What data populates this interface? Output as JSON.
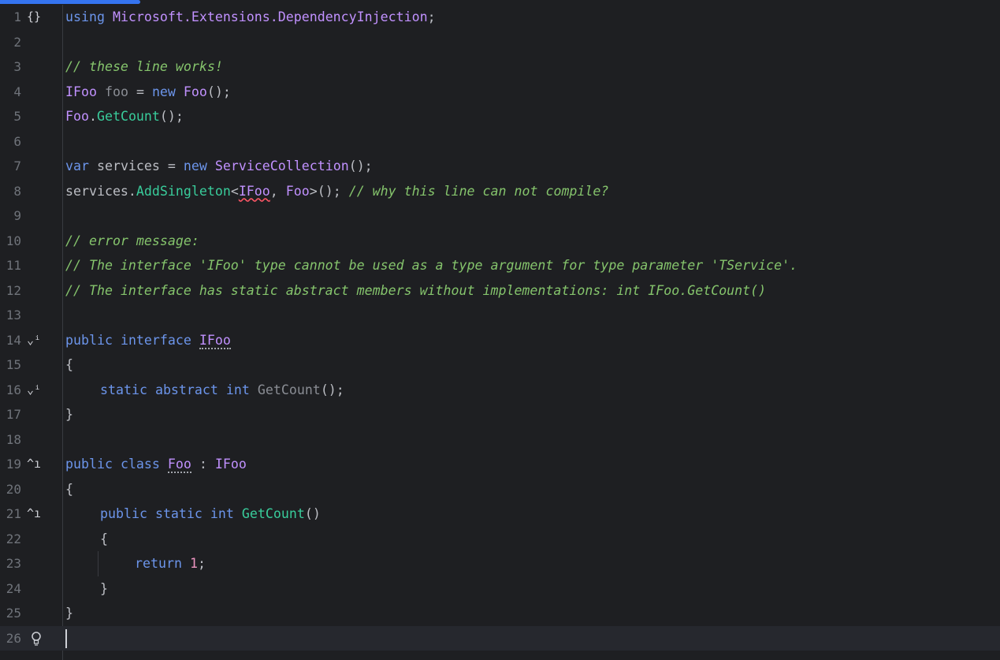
{
  "editor": {
    "line_numbers": [
      "1",
      "2",
      "3",
      "4",
      "5",
      "6",
      "7",
      "8",
      "9",
      "10",
      "11",
      "12",
      "13",
      "14",
      "15",
      "16",
      "17",
      "18",
      "19",
      "20",
      "21",
      "22",
      "23",
      "24",
      "25",
      "26"
    ],
    "gutter_icons": {
      "namespace": "{}",
      "fold": "⌄ⁱ",
      "implemented": "^ı",
      "bulb": "bulb-icon"
    },
    "code": {
      "l1": {
        "kw": "using",
        "ns": "Microsoft.Extensions.DependencyInjection",
        "semi": ";"
      },
      "l3": {
        "comment": "// these line works!"
      },
      "l4": {
        "type": "IFoo",
        "var": "foo",
        "eq": " = ",
        "new": "new",
        "ctor": "Foo",
        "rest": "();"
      },
      "l5": {
        "type": "Foo",
        "dot": ".",
        "fn": "GetCount",
        "rest": "();"
      },
      "l7": {
        "kw": "var",
        "mid": " services = ",
        "new": "new",
        "type": "ServiceCollection",
        "rest": "();"
      },
      "l8": {
        "obj": "services.",
        "fn": "AddSingleton",
        "lt": "<",
        "t1": "IFoo",
        "comma": ", ",
        "t2": "Foo",
        "rest": ">(); ",
        "comment": "// why this line can not compile?"
      },
      "l10": {
        "comment": "// error message:"
      },
      "l11": {
        "comment": "// The interface 'IFoo' type cannot be used as a type argument for type parameter 'TService'."
      },
      "l12": {
        "comment": "// The interface has static abstract members without implementations: int IFoo.GetCount()"
      },
      "l14": {
        "kw1": "public",
        "kw2": "interface",
        "name": "IFoo"
      },
      "l15": {
        "brace": "{"
      },
      "l16": {
        "kw1": "static",
        "kw2": "abstract",
        "kw3": "int",
        "fn": "GetCount",
        "rest": "();"
      },
      "l17": {
        "brace": "}"
      },
      "l19": {
        "kw1": "public",
        "kw2": "class",
        "name": "Foo",
        "colon": " : ",
        "base": "IFoo"
      },
      "l20": {
        "brace": "{"
      },
      "l21": {
        "kw1": "public",
        "kw2": "static",
        "kw3": "int",
        "fn": "GetCount",
        "rest": "()"
      },
      "l22": {
        "brace": "{"
      },
      "l23": {
        "kw": "return",
        "num": "1",
        "semi": ";"
      },
      "l24": {
        "brace": "}"
      },
      "l25": {
        "brace": "}"
      }
    }
  },
  "colors": {
    "background": "#1e1f22",
    "keyword": "#6c95eb",
    "type": "#c191ff",
    "method": "#39cc9b",
    "comment": "#85c46c",
    "number": "#ed94c0",
    "progress": "#3574f0"
  },
  "loading_progress": 0.14
}
